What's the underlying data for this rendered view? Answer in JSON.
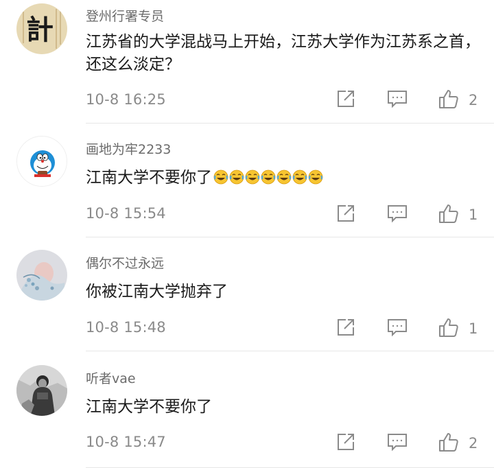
{
  "comments": [
    {
      "user": "登州行署专员",
      "text": "江苏省的大学混战马上开始，江苏大学作为江苏系之首，还这么淡定？",
      "time": "10-8 16:25",
      "likes": "2",
      "avatar": "calligraphy-avatar",
      "avatar_text": "計"
    },
    {
      "user": "画地为牢2233",
      "text": "江南大学不要你了",
      "time": "10-8 15:54",
      "likes": "1",
      "avatar": "doraemon-avatar",
      "emoji": "laugh-cry-emoji",
      "emoji_count": 7
    },
    {
      "user": "偶尔不过永远",
      "text": "你被江南大学抛弃了",
      "time": "10-8 15:48",
      "likes": "1",
      "avatar": "floral-avatar"
    },
    {
      "user": "听者vae",
      "text": "江南大学不要你了",
      "time": "10-8 15:47",
      "likes": "2",
      "avatar": "person-photo-avatar"
    }
  ],
  "icons": {
    "share": "share-icon",
    "reply": "reply-icon",
    "like": "thumbs-up-icon"
  },
  "colors": {
    "username": "#6b6b6b",
    "body": "#1a1a1a",
    "meta": "#8a8a8a",
    "divider": "#e6e6e6"
  }
}
